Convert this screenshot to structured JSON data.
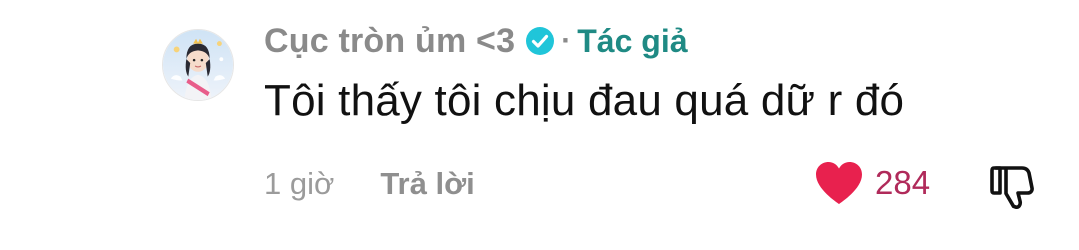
{
  "comment": {
    "author": {
      "name": "Cục tròn ủm <3",
      "verified": true,
      "separator": "·",
      "badge": "Tác giả",
      "avatar": "avatar-photo"
    },
    "text": "Tôi thấy tôi chịu đau quá dữ r đó",
    "timestamp": "1 giờ",
    "reply_label": "Trả lời",
    "likes": {
      "count": "284",
      "liked": true
    },
    "icons": {
      "verified": "verified-checkmark-icon",
      "like": "heart-icon",
      "dislike": "thumbs-down-icon"
    }
  },
  "colors": {
    "username": "#8a8a8a",
    "badge": "#1f8a84",
    "text": "#111111",
    "meta": "#9b9b9b",
    "heart": "#e8214e",
    "like_count": "#b02a5a",
    "verified": "#20c5d9"
  }
}
